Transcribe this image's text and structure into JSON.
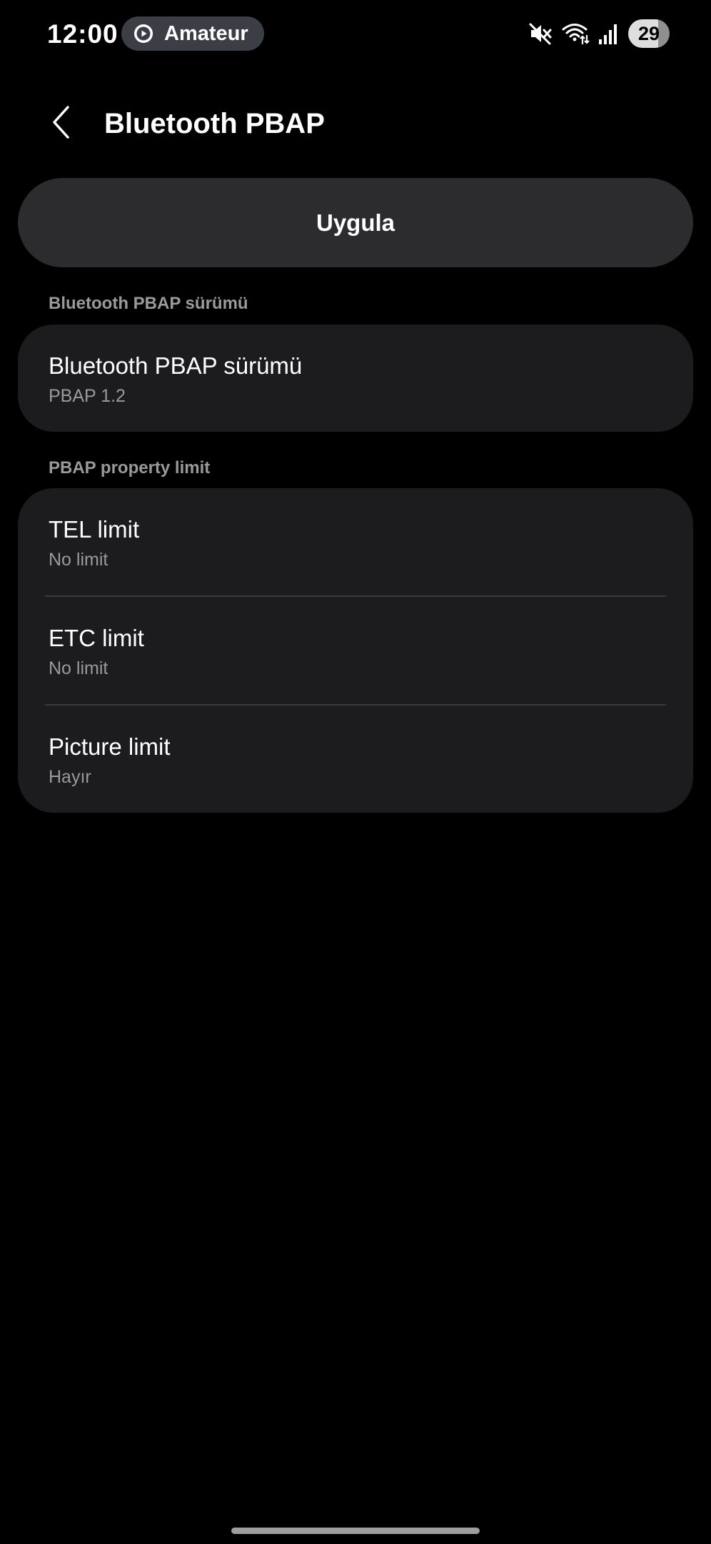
{
  "status_bar": {
    "time": "12:00",
    "pill_label": "Amateur",
    "pill_icon": "play-circle-icon",
    "icons": [
      "mute-icon",
      "wifi-icon",
      "signal-icon"
    ],
    "battery": "29"
  },
  "app_bar": {
    "back_icon": "chevron-left-icon",
    "title": "Bluetooth PBAP"
  },
  "apply_button": {
    "label": "Uygula"
  },
  "sections": {
    "version": {
      "header": "Bluetooth PBAP sürümü",
      "items": [
        {
          "title": "Bluetooth PBAP sürümü",
          "summary": "PBAP 1.2"
        }
      ]
    },
    "property_limit": {
      "header": "PBAP property limit",
      "items": [
        {
          "title": "TEL limit",
          "summary": "No limit"
        },
        {
          "title": "ETC limit",
          "summary": "No limit"
        },
        {
          "title": "Picture limit",
          "summary": "Hayır"
        }
      ]
    }
  },
  "colors": {
    "background": "#000000",
    "card": "#1c1c1e",
    "button": "#2c2c2e",
    "secondary_text": "#9a9a9a",
    "pill": "#3b3e44"
  }
}
